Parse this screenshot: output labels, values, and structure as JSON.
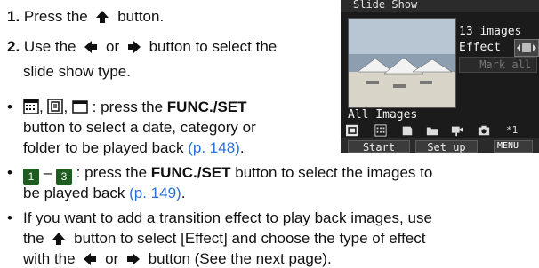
{
  "step1": {
    "num": "1.",
    "text_a": "Press the",
    "text_b": "button."
  },
  "step2": {
    "num": "2.",
    "text_a": "Use the",
    "text_or": "or",
    "text_b": "button to select the",
    "text_c": "slide show type."
  },
  "bullet1": {
    "sep1": ",",
    "sep2": ",",
    "text_a": ": press the",
    "bold": "FUNC./SET",
    "text_b": "button to select a date, category or",
    "text_c": "folder to be played back",
    "link": "(p. 148)",
    "end": "."
  },
  "bullet2": {
    "badge_a": "1",
    "dash": "–",
    "badge_b": "3",
    "text_a": ": press the",
    "bold": "FUNC./SET",
    "text_b": "button to select the images to",
    "text_c": "be played back",
    "link": "(p. 149)",
    "end": "."
  },
  "bullet3": {
    "line1": "If you want to add a transition effect to play back images, use",
    "line2_a": "the",
    "line2_b": "button to select [Effect] and choose the type of effect",
    "line3_a": "with the",
    "line3_or": "or",
    "line3_b": "button (See the next page)."
  },
  "camera": {
    "title": "Slide Show",
    "count": "13 images",
    "effect": "Effect",
    "mark_all": "Mark all",
    "all_images": "All Images",
    "start": "Start",
    "setup": "Set up",
    "menu": "MENU",
    "icon_last": "*1"
  },
  "colors": {
    "link": "#2a6fd6"
  }
}
